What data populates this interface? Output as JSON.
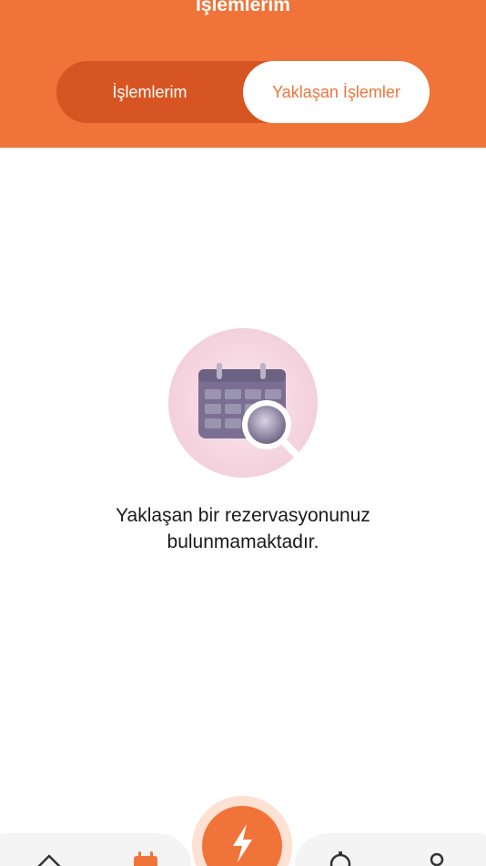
{
  "header": {
    "title": "İşlemlerim",
    "tabs": [
      {
        "label": "İşlemlerim",
        "selected": false
      },
      {
        "label": "Yaklaşan İşlemler",
        "selected": true
      }
    ]
  },
  "empty_state": {
    "message_line1": "Yaklaşan bir rezervasyonunuz",
    "message_line2": "bulunmamaktadır."
  },
  "tab_bar": {
    "items": [
      {
        "icon": "home-icon"
      },
      {
        "icon": "calendar-icon",
        "active": true
      },
      {
        "icon": "lightning-icon"
      },
      {
        "icon": "notification-icon"
      },
      {
        "icon": "location-icon"
      }
    ]
  },
  "colors": {
    "accent": "#f0743a",
    "accent_dark": "#d65522",
    "illustration": "#7a6f92"
  }
}
